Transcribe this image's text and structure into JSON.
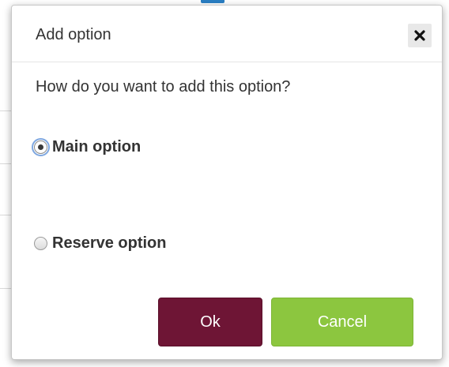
{
  "dialog": {
    "title": "Add option",
    "close_icon": "close-icon",
    "question": "How do you want to add this option?",
    "options": [
      {
        "label": "Main option",
        "selected": true
      },
      {
        "label": "Reserve option",
        "selected": false
      }
    ],
    "buttons": {
      "ok_label": "Ok",
      "cancel_label": "Cancel"
    }
  },
  "colors": {
    "ok_button": "#6e1535",
    "cancel_button": "#8cc63f",
    "text": "#333333"
  }
}
